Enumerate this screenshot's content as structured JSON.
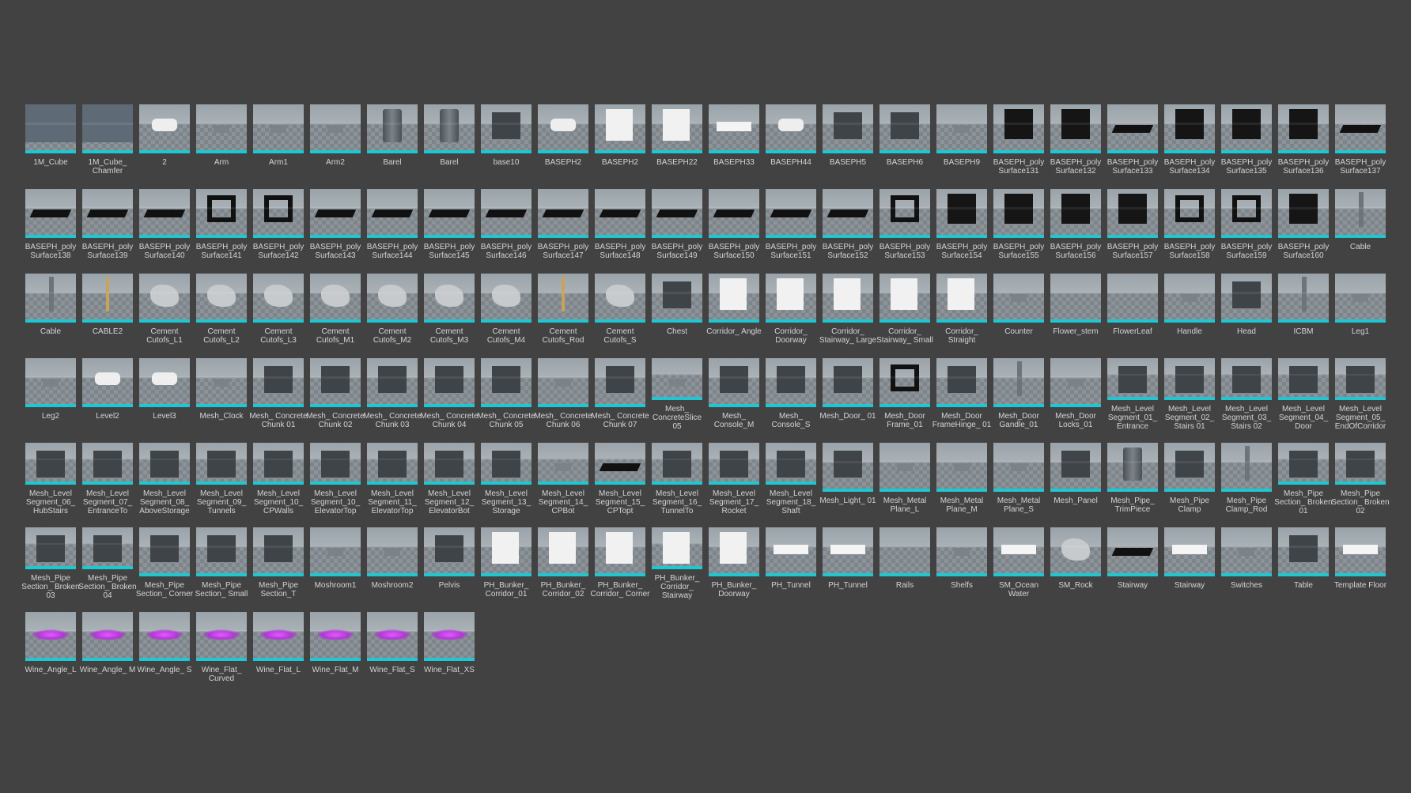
{
  "assets": [
    {
      "label": "1M_Cube",
      "shape": "big"
    },
    {
      "label": "1M_Cube_ Chamfer",
      "shape": "big"
    },
    {
      "label": "2",
      "shape": "blob"
    },
    {
      "label": "Arm",
      "shape": "small"
    },
    {
      "label": "Arm1",
      "shape": "small"
    },
    {
      "label": "Arm2",
      "shape": "small"
    },
    {
      "label": "Barel",
      "shape": "cyl"
    },
    {
      "label": "Barel",
      "shape": "cyl"
    },
    {
      "label": "base10",
      "shape": "dark"
    },
    {
      "label": "BASEPH2",
      "shape": "blob"
    },
    {
      "label": "BASEPH2",
      "shape": "white"
    },
    {
      "label": "BASEPH22",
      "shape": "white"
    },
    {
      "label": "BASEPH33",
      "shape": "whiteflat"
    },
    {
      "label": "BASEPH44",
      "shape": "blob"
    },
    {
      "label": "BASEPH5",
      "shape": "dark"
    },
    {
      "label": "BASEPH6",
      "shape": "dark"
    },
    {
      "label": "BASEPH9",
      "shape": "small"
    },
    {
      "label": "BASEPH_poly Surface131",
      "shape": "wall"
    },
    {
      "label": "BASEPH_poly Surface132",
      "shape": "wall"
    },
    {
      "label": "BASEPH_poly Surface133",
      "shape": "flat"
    },
    {
      "label": "BASEPH_poly Surface134",
      "shape": "wall"
    },
    {
      "label": "BASEPH_poly Surface135",
      "shape": "wall"
    },
    {
      "label": "BASEPH_poly Surface136",
      "shape": "wall"
    },
    {
      "label": "BASEPH_poly Surface137",
      "shape": "flat"
    },
    {
      "label": "BASEPH_poly Surface138",
      "shape": "flat"
    },
    {
      "label": "BASEPH_poly Surface139",
      "shape": "flat"
    },
    {
      "label": "BASEPH_poly Surface140",
      "shape": "flat"
    },
    {
      "label": "BASEPH_poly Surface141",
      "shape": "ring"
    },
    {
      "label": "BASEPH_poly Surface142",
      "shape": "ring"
    },
    {
      "label": "BASEPH_poly Surface143",
      "shape": "flat"
    },
    {
      "label": "BASEPH_poly Surface144",
      "shape": "flat"
    },
    {
      "label": "BASEPH_poly Surface145",
      "shape": "flat"
    },
    {
      "label": "BASEPH_poly Surface146",
      "shape": "flat"
    },
    {
      "label": "BASEPH_poly Surface147",
      "shape": "flat"
    },
    {
      "label": "BASEPH_poly Surface148",
      "shape": "flat"
    },
    {
      "label": "BASEPH_poly Surface149",
      "shape": "flat"
    },
    {
      "label": "BASEPH_poly Surface150",
      "shape": "flat"
    },
    {
      "label": "BASEPH_poly Surface151",
      "shape": "flat"
    },
    {
      "label": "BASEPH_poly Surface152",
      "shape": "flat"
    },
    {
      "label": "BASEPH_poly Surface153",
      "shape": "ring"
    },
    {
      "label": "BASEPH_poly Surface154",
      "shape": "wall"
    },
    {
      "label": "BASEPH_poly Surface155",
      "shape": "wall"
    },
    {
      "label": "BASEPH_poly Surface156",
      "shape": "wall"
    },
    {
      "label": "BASEPH_poly Surface157",
      "shape": "wall"
    },
    {
      "label": "BASEPH_poly Surface158",
      "shape": "ring"
    },
    {
      "label": "BASEPH_poly Surface159",
      "shape": "ring"
    },
    {
      "label": "BASEPH_poly Surface160",
      "shape": "wall"
    },
    {
      "label": "Cable",
      "shape": "pole"
    },
    {
      "label": "Cable",
      "shape": "pole"
    },
    {
      "label": "CABLE2",
      "shape": "thin"
    },
    {
      "label": "Cement Cutofs_L1",
      "shape": "rock"
    },
    {
      "label": "Cement Cutofs_L2",
      "shape": "rock"
    },
    {
      "label": "Cement Cutofs_L3",
      "shape": "rock"
    },
    {
      "label": "Cement Cutofs_M1",
      "shape": "rock"
    },
    {
      "label": "Cement Cutofs_M2",
      "shape": "rock"
    },
    {
      "label": "Cement Cutofs_M3",
      "shape": "rock"
    },
    {
      "label": "Cement Cutofs_M4",
      "shape": "rock"
    },
    {
      "label": "Cement Cutofs_Rod",
      "shape": "thin"
    },
    {
      "label": "Cement Cutofs_S",
      "shape": "rock"
    },
    {
      "label": "Chest",
      "shape": "dark"
    },
    {
      "label": "Corridor_ Angle",
      "shape": "white"
    },
    {
      "label": "Corridor_ Doorway",
      "shape": "white"
    },
    {
      "label": "Corridor_ Stairway_ Large",
      "shape": "white"
    },
    {
      "label": "Corridor_ Stairway_ Small",
      "shape": "white"
    },
    {
      "label": "Corridor_ Straight",
      "shape": "white"
    },
    {
      "label": "Counter",
      "shape": "small"
    },
    {
      "label": "Flower_stem",
      "shape": "none"
    },
    {
      "label": "FlowerLeaf",
      "shape": "none"
    },
    {
      "label": "Handle",
      "shape": "small"
    },
    {
      "label": "Head",
      "shape": "dark"
    },
    {
      "label": "ICBM",
      "shape": "pole"
    },
    {
      "label": "Leg1",
      "shape": "small"
    },
    {
      "label": "Leg2",
      "shape": "small"
    },
    {
      "label": "Level2",
      "shape": "blob"
    },
    {
      "label": "Level3",
      "shape": "blob"
    },
    {
      "label": "Mesh_Clock",
      "shape": "small"
    },
    {
      "label": "Mesh_ Concrete Chunk 01",
      "shape": "dark"
    },
    {
      "label": "Mesh_ Concrete Chunk 02",
      "shape": "dark"
    },
    {
      "label": "Mesh_ Concrete Chunk 03",
      "shape": "dark"
    },
    {
      "label": "Mesh_ Concrete Chunk 04",
      "shape": "dark"
    },
    {
      "label": "Mesh_ Concrete Chunk 05",
      "shape": "dark"
    },
    {
      "label": "Mesh_ Concrete Chunk 06",
      "shape": "small"
    },
    {
      "label": "Mesh_ Concrete Chunk 07",
      "shape": "dark"
    },
    {
      "label": "Mesh_ ConcreteSlice 05",
      "shape": "small"
    },
    {
      "label": "Mesh_ Console_M",
      "shape": "dark"
    },
    {
      "label": "Mesh_ Console_S",
      "shape": "dark"
    },
    {
      "label": "Mesh_Door_ 01",
      "shape": "dark"
    },
    {
      "label": "Mesh_Door Frame_01",
      "shape": "ring"
    },
    {
      "label": "Mesh_Door FrameHinge_ 01",
      "shape": "dark"
    },
    {
      "label": "Mesh_Door Gandle_01",
      "shape": "pole"
    },
    {
      "label": "Mesh_Door Locks_01",
      "shape": "small"
    },
    {
      "label": "Mesh_Level Segment_01_ Entrance",
      "shape": "dark"
    },
    {
      "label": "Mesh_Level Segment_02_ Stairs 01",
      "shape": "dark"
    },
    {
      "label": "Mesh_Level Segment_03_ Stairs 02",
      "shape": "dark"
    },
    {
      "label": "Mesh_Level Segment_04_ Door",
      "shape": "dark"
    },
    {
      "label": "Mesh_Level Segment_05_ EndOfCorridor",
      "shape": "dark"
    },
    {
      "label": "Mesh_Level Segment_06_ HubStairs",
      "shape": "dark"
    },
    {
      "label": "Mesh_Level Segment_07_ EntranceTo",
      "shape": "dark"
    },
    {
      "label": "Mesh_Level Segment_08_ AboveStorage",
      "shape": "dark"
    },
    {
      "label": "Mesh_Level Segment_09_ Tunnels",
      "shape": "dark"
    },
    {
      "label": "Mesh_Level Segment_10_ CPWalls",
      "shape": "dark"
    },
    {
      "label": "Mesh_Level Segment_10_ ElevatorTop",
      "shape": "dark"
    },
    {
      "label": "Mesh_Level Segment_11_ ElevatorTop",
      "shape": "dark"
    },
    {
      "label": "Mesh_Level Segment_12_ ElevatorBot",
      "shape": "dark"
    },
    {
      "label": "Mesh_Level Segment_13_ Storage",
      "shape": "dark"
    },
    {
      "label": "Mesh_Level Segment_14_ CPBot",
      "shape": "small"
    },
    {
      "label": "Mesh_Level Segment_15_ CPTopt",
      "shape": "flat"
    },
    {
      "label": "Mesh_Level Segment_16_ TunnelTo",
      "shape": "dark"
    },
    {
      "label": "Mesh_Level Segment_17_ Rocket",
      "shape": "dark"
    },
    {
      "label": "Mesh_Level Segment_18_ Shaft",
      "shape": "dark"
    },
    {
      "label": "Mesh_Light_ 01",
      "shape": "dark"
    },
    {
      "label": "Mesh_Metal Plane_L",
      "shape": "small"
    },
    {
      "label": "Mesh_Metal Plane_M",
      "shape": "small"
    },
    {
      "label": "Mesh_Metal Plane_S",
      "shape": "small"
    },
    {
      "label": "Mesh_Panel",
      "shape": "dark"
    },
    {
      "label": "Mesh_Pipe_ TrimPiece",
      "shape": "cyl"
    },
    {
      "label": "Mesh_Pipe Clamp",
      "shape": "dark"
    },
    {
      "label": "Mesh_Pipe Clamp_Rod",
      "shape": "pole"
    },
    {
      "label": "Mesh_Pipe Section_ Broken 01",
      "shape": "dark"
    },
    {
      "label": "Mesh_Pipe Section_ Broken 02",
      "shape": "dark"
    },
    {
      "label": "Mesh_Pipe Section_ Broken 03",
      "shape": "dark"
    },
    {
      "label": "Mesh_Pipe Section_ Broken 04",
      "shape": "dark"
    },
    {
      "label": "Mesh_Pipe Section_ Corner",
      "shape": "dark"
    },
    {
      "label": "Mesh_Pipe Section_ Small",
      "shape": "dark"
    },
    {
      "label": "Mesh_Pipe Section_T",
      "shape": "dark"
    },
    {
      "label": "Moshroom1",
      "shape": "small"
    },
    {
      "label": "Moshroom2",
      "shape": "small"
    },
    {
      "label": "Pelvis",
      "shape": "dark"
    },
    {
      "label": "PH_Bunker_ Corridor_01",
      "shape": "white"
    },
    {
      "label": "PH_Bunker_ Corridor_02",
      "shape": "white"
    },
    {
      "label": "PH_Bunker_ Corridor_ Corner",
      "shape": "white"
    },
    {
      "label": "PH_Bunker_ Corridor_ Stairway",
      "shape": "white"
    },
    {
      "label": "PH_Bunker_ Doorway",
      "shape": "white"
    },
    {
      "label": "PH_Tunnel",
      "shape": "whiteflat"
    },
    {
      "label": "PH_Tunnel",
      "shape": "whiteflat"
    },
    {
      "label": "Rails",
      "shape": "none"
    },
    {
      "label": "Shelfs",
      "shape": "small"
    },
    {
      "label": "SM_Ocean Water",
      "shape": "whiteflat"
    },
    {
      "label": "SM_Rock",
      "shape": "rock"
    },
    {
      "label": "Stairway",
      "shape": "flat"
    },
    {
      "label": "Stairway",
      "shape": "whiteflat"
    },
    {
      "label": "Switches",
      "shape": "small"
    },
    {
      "label": "Table",
      "shape": "dark"
    },
    {
      "label": "Template Floor",
      "shape": "whiteflat"
    },
    {
      "label": "Wine_Angle_L",
      "shape": "pink"
    },
    {
      "label": "Wine_Angle_ M",
      "shape": "pink"
    },
    {
      "label": "Wine_Angle_ S",
      "shape": "pink"
    },
    {
      "label": "Wine_Flat_ Curved",
      "shape": "pink"
    },
    {
      "label": "Wine_Flat_L",
      "shape": "pink"
    },
    {
      "label": "Wine_Flat_M",
      "shape": "pink"
    },
    {
      "label": "Wine_Flat_S",
      "shape": "pink"
    },
    {
      "label": "Wine_Flat_XS",
      "shape": "pink"
    }
  ]
}
